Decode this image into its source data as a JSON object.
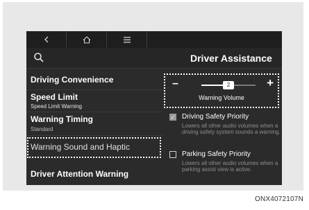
{
  "topbar": {
    "back_icon": "chevron-left-icon",
    "home_icon": "home-icon",
    "menu_icon": "hamburger-menu-icon"
  },
  "header": {
    "search_icon": "search-icon",
    "title": "Driver Assistance"
  },
  "menu": [
    {
      "label": "Driving Convenience",
      "sub": ""
    },
    {
      "label": "Speed Limit",
      "sub": "Speed Limit Warning"
    },
    {
      "label": "Warning Timing",
      "sub": "Standard"
    },
    {
      "label": "Warning Sound and Haptic",
      "sub": ""
    },
    {
      "label": "Driver Attention Warning",
      "sub": ""
    }
  ],
  "volume": {
    "minus": "–",
    "plus": "+",
    "value": "2",
    "level_fraction": 0.5,
    "label": "Warning Volume"
  },
  "options": [
    {
      "title": "Driving Safety Priority",
      "desc": "Lowers all other audio volumes when a driving safety system sounds a warning.",
      "checked": true
    },
    {
      "title": "Parking Safety Priority",
      "desc": "Lowers all other audio volumes when a parking assist view is active.",
      "checked": false
    }
  ],
  "caption": "ONX4072107N"
}
